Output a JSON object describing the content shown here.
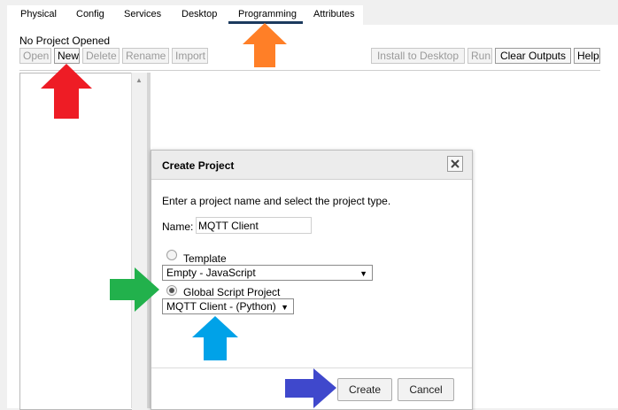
{
  "tabs": [
    {
      "label": "Physical"
    },
    {
      "label": "Config"
    },
    {
      "label": "Services"
    },
    {
      "label": "Desktop"
    },
    {
      "label": "Programming"
    },
    {
      "label": "Attributes"
    }
  ],
  "active_tab": "Programming",
  "status": "No Project Opened",
  "toolbar": {
    "open": "Open",
    "new": "New",
    "delete": "Delete",
    "rename": "Rename",
    "import": "Import",
    "install": "Install to Desktop",
    "run": "Run",
    "clear_outputs": "Clear Outputs",
    "help": "Help"
  },
  "dialog": {
    "title": "Create Project",
    "instruction": "Enter a project name and select the project type.",
    "name_label": "Name:",
    "name_value": "MQTT Client",
    "template_label": "Template",
    "template_select": "Empty - JavaScript",
    "template_selected": false,
    "global_label": "Global Script Project",
    "global_select": "MQTT Client - (Python)",
    "global_selected": true,
    "create": "Create",
    "cancel": "Cancel"
  },
  "colors": {
    "arrow_red": "#ee1c25",
    "arrow_orange": "#ff7f27",
    "arrow_green": "#22b14c",
    "arrow_cyan": "#00a2e8",
    "arrow_indigo": "#3f48cc",
    "tab_underline": "#1c3a5e"
  }
}
